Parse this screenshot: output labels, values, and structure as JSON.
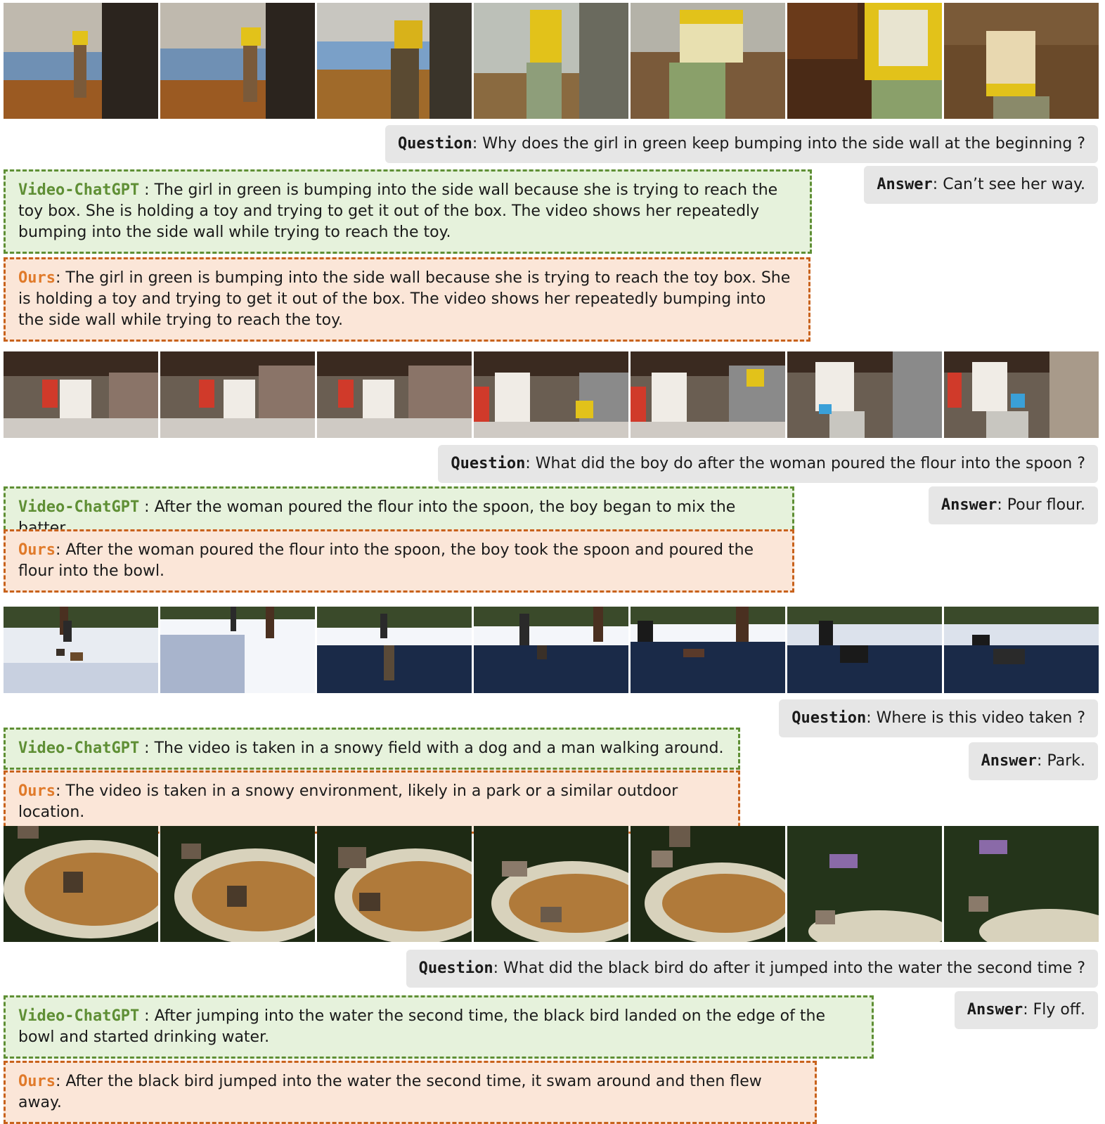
{
  "labels": {
    "question": "Question",
    "answer": "Answer",
    "videochatgpt": "Video-ChatGPT",
    "ours": "Ours"
  },
  "examples": [
    {
      "question": ": Why does the girl in green keep bumping into the side wall at the beginning ?",
      "answer": ": Can’t see her way.",
      "videochatgpt": " : The girl in green is bumping into the side wall because she is trying to reach the toy box. She is holding a toy and trying to get it out of the box. The video shows her repeatedly bumping into the side wall while trying to reach the toy.",
      "ours": ": The girl in green is bumping into the side wall because she is trying to reach the toy box. She is holding a toy and trying to get it out of the box. The video shows her repeatedly bumping into the side wall while trying to reach the toy."
    },
    {
      "question": ": What did the boy do after the woman poured the flour into the spoon ?",
      "answer": ": Pour flour.",
      "videochatgpt": " : After the woman poured the flour into the spoon, the boy began to mix the batter.",
      "ours": ": After the woman poured the flour into the spoon, the boy took the spoon and poured the flour into the bowl."
    },
    {
      "question": ": Where is this video taken ?",
      "answer": ": Park.",
      "videochatgpt": " : The video is taken in a snowy field with a dog and a man walking around.",
      "ours": ": The video is taken in a snowy environment, likely in a park or a similar outdoor location."
    },
    {
      "question": ": What did the black bird do after it jumped into the water the second time ?",
      "answer": ": Fly off.",
      "videochatgpt": " : After jumping into the water the second time, the black bird landed on the edge of the bowl and started drinking water.",
      "ours": ": After the black bird jumped into the water the second time, it swam around and then flew away."
    }
  ]
}
